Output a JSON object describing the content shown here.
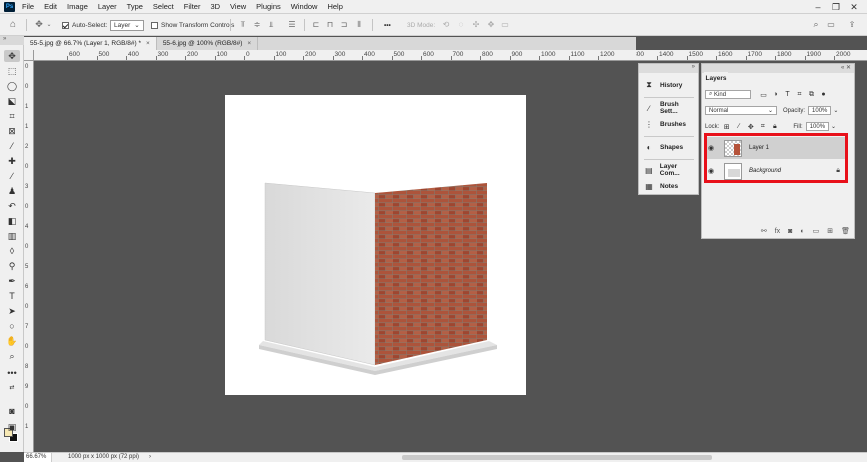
{
  "menubar": {
    "logo": "Ps",
    "items": [
      "File",
      "Edit",
      "Image",
      "Layer",
      "Type",
      "Select",
      "Filter",
      "3D",
      "View",
      "Plugins",
      "Window",
      "Help"
    ],
    "window_controls": [
      "minimize-icon",
      "restore-icon",
      "close-icon"
    ]
  },
  "options_bar": {
    "auto_select_label": "Auto-Select:",
    "auto_select_checked": true,
    "auto_select_target": "Layer",
    "transform_controls_label": "Show Transform Controls",
    "transform_controls_checked": false,
    "mode_3d_label": "3D Mode:",
    "more_label": "•••"
  },
  "tabs": [
    {
      "label": "55-5.jpg @ 66.7% (Layer 1, RGB/8#) *",
      "active": true
    },
    {
      "label": "55-6.jpg @ 100% (RGB/8#)",
      "active": false
    }
  ],
  "ruler_h_labels": [
    "600",
    "500",
    "400",
    "300",
    "200",
    "100",
    "0",
    "100",
    "200",
    "300",
    "400",
    "500",
    "600",
    "700",
    "800",
    "900",
    "1000",
    "1100",
    "1200",
    "1300",
    "1400",
    "1500",
    "1600",
    "1700",
    "1800",
    "1900",
    "2000"
  ],
  "ruler_v_labels": [
    "0",
    "0",
    "1",
    "1",
    "2",
    "0",
    "3",
    "0",
    "4",
    "0",
    "5",
    "6",
    "0",
    "7",
    "0",
    "8",
    "9",
    "0",
    "1"
  ],
  "mini_panel": {
    "items": [
      {
        "label": "History",
        "icon": "history-icon"
      },
      {
        "label": "Brush Sett...",
        "icon": "brush-settings-icon"
      },
      {
        "label": "Brushes",
        "icon": "brushes-icon"
      },
      {
        "label": "Shapes",
        "icon": "shapes-icon"
      },
      {
        "label": "Layer Com...",
        "icon": "layer-comps-icon"
      },
      {
        "label": "Notes",
        "icon": "notes-icon"
      }
    ]
  },
  "layers_panel": {
    "tab_label": "Layers",
    "filter_kind": "Kind",
    "blend_mode": "Normal",
    "opacity_label": "Opacity:",
    "opacity_value": "100%",
    "lock_label": "Lock:",
    "fill_label": "Fill:",
    "fill_value": "100%",
    "layers": [
      {
        "name": "Layer 1",
        "visible": true,
        "selected": true,
        "locked": false
      },
      {
        "name": "Background",
        "visible": true,
        "selected": false,
        "locked": true
      }
    ],
    "highlight_color": "#e8101a"
  },
  "status": {
    "zoom": "66.67%",
    "doc_info": "1000 px x 1000 px (72 ppi)",
    "arrow": "›"
  },
  "colors": {
    "foreground": "#f7e9b5",
    "background": "#111111",
    "workspace": "#535353"
  }
}
